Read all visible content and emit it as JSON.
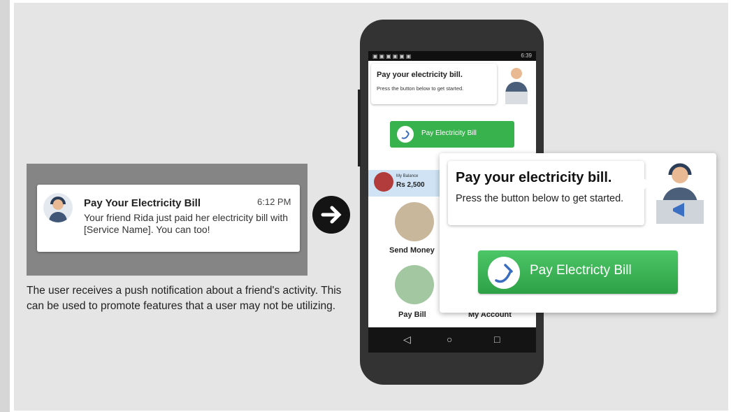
{
  "notification": {
    "title": "Pay Your Electricity Bill",
    "time": "6:12 PM",
    "body": "Your friend Rida just paid her electricity bill with [Service Name]. You can too!"
  },
  "caption": "The user receives a push notification about a friend's activity. This can be used to promote features that a user may not be utilizing.",
  "phone": {
    "status_time": "6:39",
    "bubble_title": "Pay your electricity bill.",
    "bubble_sub": "Press the button below to get started.",
    "button_label": "Pay Electricity Bill",
    "balance_label": "My Balance",
    "balance_value": "Rs 2,500",
    "tiles": [
      "Send Money",
      "Pay Bill",
      "My Account"
    ],
    "nav": [
      "◁",
      "○",
      "□"
    ]
  },
  "zoom": {
    "bubble_title": "Pay your electricity bill.",
    "bubble_sub": "Press the button below to get started.",
    "button_label": "Pay Electricty Bill"
  },
  "colors": {
    "green": "#37b24d",
    "background": "#e5e5e5",
    "notif_panel": "#858585"
  }
}
